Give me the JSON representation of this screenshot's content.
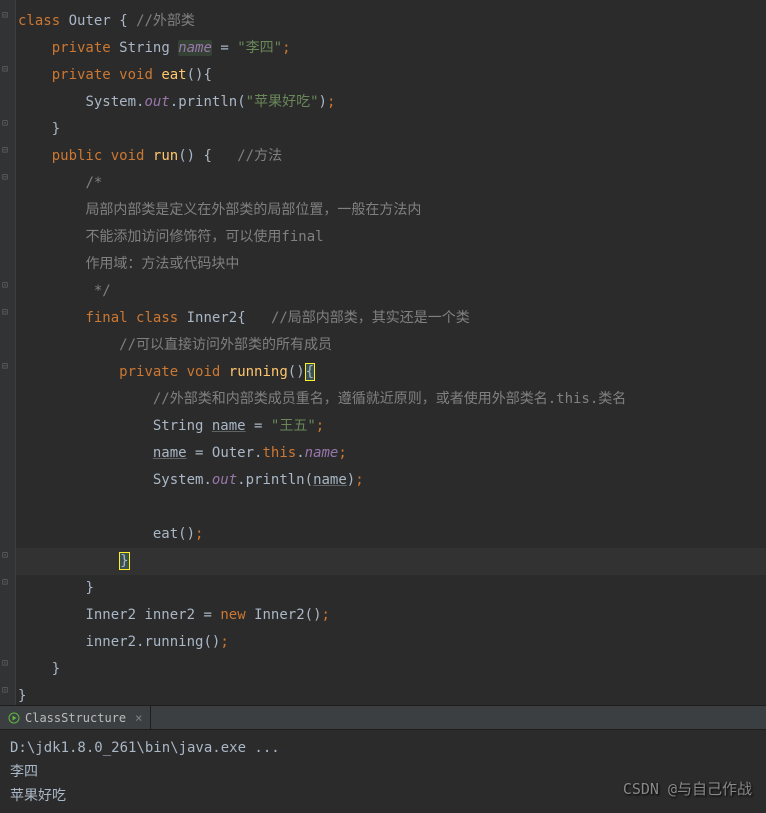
{
  "code": {
    "l1": {
      "k1": "class",
      "cls": "Outer",
      "brace": "{",
      "c": "//外部类"
    },
    "l2": {
      "k1": "private",
      "type": "String",
      "name": "name",
      "eq": "=",
      "val": "\"李四\"",
      "semi": ";"
    },
    "l3": {
      "k1": "private",
      "k2": "void",
      "m": "eat",
      "p": "(){",
      "close": ""
    },
    "l4": {
      "obj": "System",
      "dot1": ".",
      "out": "out",
      "dot2": ".",
      "m": "println",
      "open": "(",
      "str": "\"苹果好吃\"",
      "close": ")",
      "semi": ";"
    },
    "l5": {
      "brace": "}"
    },
    "l6": {
      "k1": "public",
      "k2": "void",
      "m": "run",
      "p": "()",
      "brace": "{",
      "c": "//方法"
    },
    "l7": {
      "c": "/*"
    },
    "l8": {
      "c": "局部内部类是定义在外部类的局部位置，一般在方法内"
    },
    "l9": {
      "c": "不能添加访问修饰符，可以使用final"
    },
    "l10": {
      "c": "作用域：方法或代码块中"
    },
    "l11": {
      "c": " */"
    },
    "l12": {
      "k1": "final",
      "k2": "class",
      "cls": "Inner2",
      "brace": "{",
      "c": "//局部内部类，其实还是一个类"
    },
    "l13": {
      "c": "//可以直接访问外部类的所有成员"
    },
    "l14": {
      "k1": "private",
      "k2": "void",
      "m": "running",
      "p": "()",
      "brace": "{"
    },
    "l15": {
      "c": "//外部类和内部类成员重名，遵循就近原则，或者使用外部类名.this.类名"
    },
    "l16": {
      "type": "String",
      "name": "name",
      "eq": "=",
      "val": "\"王五\"",
      "semi": ";"
    },
    "l17": {
      "name": "name",
      "eq": "=",
      "cls": "Outer",
      "dot1": ".",
      "k": "this",
      "dot2": ".",
      "field": "name",
      "semi": ";"
    },
    "l18": {
      "obj": "System",
      "dot1": ".",
      "out": "out",
      "dot2": ".",
      "m": "println",
      "open": "(",
      "arg": "name",
      "close": ")",
      "semi": ";"
    },
    "l19": {
      "blank": ""
    },
    "l20": {
      "m": "eat",
      "p": "()",
      "semi": ";"
    },
    "l21": {
      "brace": "}"
    },
    "l22": {
      "brace": "}"
    },
    "l23": {
      "type": "Inner2",
      "var": "inner2",
      "eq": "=",
      "k": "new",
      "cls": "Inner2",
      "p": "()",
      "semi": ";"
    },
    "l24": {
      "var": "inner2",
      "dot": ".",
      "m": "running",
      "p": "()",
      "semi": ";"
    },
    "l25": {
      "brace": "}"
    },
    "l26": {
      "brace": "}"
    }
  },
  "tab": {
    "name": "ClassStructure"
  },
  "console": {
    "l1": "D:\\jdk1.8.0_261\\bin\\java.exe ...",
    "l2": "李四",
    "l3": "苹果好吃"
  },
  "watermark": "CSDN @与自己作战"
}
